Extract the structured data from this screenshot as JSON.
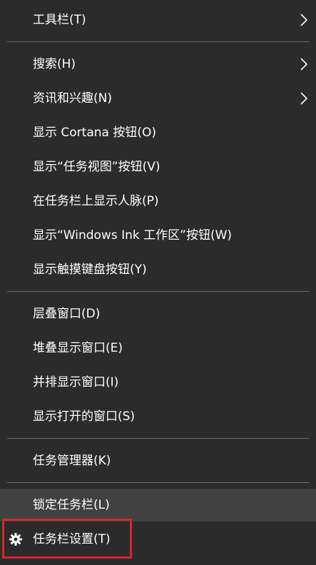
{
  "menu": {
    "items": [
      {
        "label": "工具栏(T)",
        "submenu": true
      },
      {
        "label": "搜索(H)",
        "submenu": true
      },
      {
        "label": "资讯和兴趣(N)",
        "submenu": true
      },
      {
        "label": "显示 Cortana 按钮(O)"
      },
      {
        "label": "显示“任务视图”按钮(V)"
      },
      {
        "label": "在任务栏上显示人脉(P)"
      },
      {
        "label": "显示“Windows Ink 工作区”按钮(W)"
      },
      {
        "label": "显示触摸键盘按钮(Y)"
      },
      {
        "label": "层叠窗口(D)"
      },
      {
        "label": "堆叠显示窗口(E)"
      },
      {
        "label": "并排显示窗口(I)"
      },
      {
        "label": "显示打开的窗口(S)"
      },
      {
        "label": "任务管理器(K)"
      },
      {
        "label": "锁定任务栏(L)",
        "state": "hovered"
      },
      {
        "label": "任务栏设置(T)",
        "icon": "gear-icon",
        "state": "highlighted"
      }
    ]
  },
  "colors": {
    "background": "#2b2b2b",
    "hover": "#414141",
    "separator": "#6a6a6a",
    "highlight_border": "#d9262c",
    "text": "#ffffff"
  }
}
